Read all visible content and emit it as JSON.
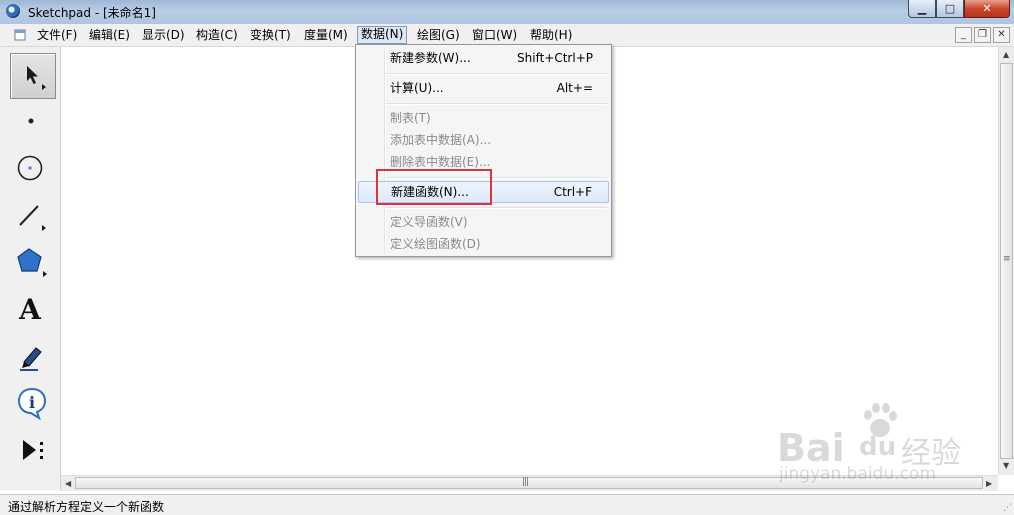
{
  "window": {
    "title": "Sketchpad  - [未命名1]",
    "caption_buttons": {
      "minimize": "▁",
      "maximize": "□",
      "close": "✕"
    }
  },
  "menubar": {
    "items": [
      {
        "label": "文件(F)"
      },
      {
        "label": "编辑(E)"
      },
      {
        "label": "显示(D)"
      },
      {
        "label": "构造(C)"
      },
      {
        "label": "变换(T)"
      },
      {
        "label": "度量(M)"
      },
      {
        "label": "数据(N)"
      },
      {
        "label": "绘图(G)"
      },
      {
        "label": "窗口(W)"
      },
      {
        "label": "帮助(H)"
      }
    ],
    "open_menu": "数据(N)",
    "mdi_buttons": {
      "minimize": "_",
      "restore": "❐",
      "close": "✕"
    }
  },
  "data_menu": {
    "items": [
      {
        "label": "新建参数(W)...",
        "shortcut": "Shift+Ctrl+P",
        "enabled": true
      },
      {
        "label": "计算(U)...",
        "shortcut": "Alt+=",
        "enabled": true
      },
      {
        "label": "制表(T)",
        "shortcut": "",
        "enabled": false
      },
      {
        "label": "添加表中数据(A)...",
        "shortcut": "",
        "enabled": false
      },
      {
        "label": "删除表中数据(E)...",
        "shortcut": "",
        "enabled": false
      },
      {
        "label": "新建函数(N)...",
        "shortcut": "Ctrl+F",
        "enabled": true,
        "highlighted": true
      },
      {
        "label": "定义导函数(V)",
        "shortcut": "",
        "enabled": false
      },
      {
        "label": "定义绘图函数(D)",
        "shortcut": "",
        "enabled": false
      }
    ]
  },
  "toolbox": {
    "tools": [
      {
        "icon": "arrow-select-icon",
        "selected": true
      },
      {
        "icon": "point-tool-icon"
      },
      {
        "icon": "compass-tool-icon"
      },
      {
        "icon": "line-tool-icon"
      },
      {
        "icon": "polygon-tool-icon"
      },
      {
        "icon": "text-tool-icon",
        "glyph": "A"
      },
      {
        "icon": "marker-tool-icon"
      },
      {
        "icon": "information-tool-icon",
        "glyph": "i"
      },
      {
        "icon": "custom-tool-icon"
      }
    ]
  },
  "status_bar": {
    "text": "通过解析方程定义一个新函数"
  },
  "watermark": {
    "brand": "Bai",
    "brand2": "du",
    "cn": "经验",
    "url": "jingyan.baidu.com"
  },
  "colors": {
    "highlight_box": "#d9353a",
    "titlebar": "#b9cde6",
    "menu_hover": "#dde9f9"
  }
}
